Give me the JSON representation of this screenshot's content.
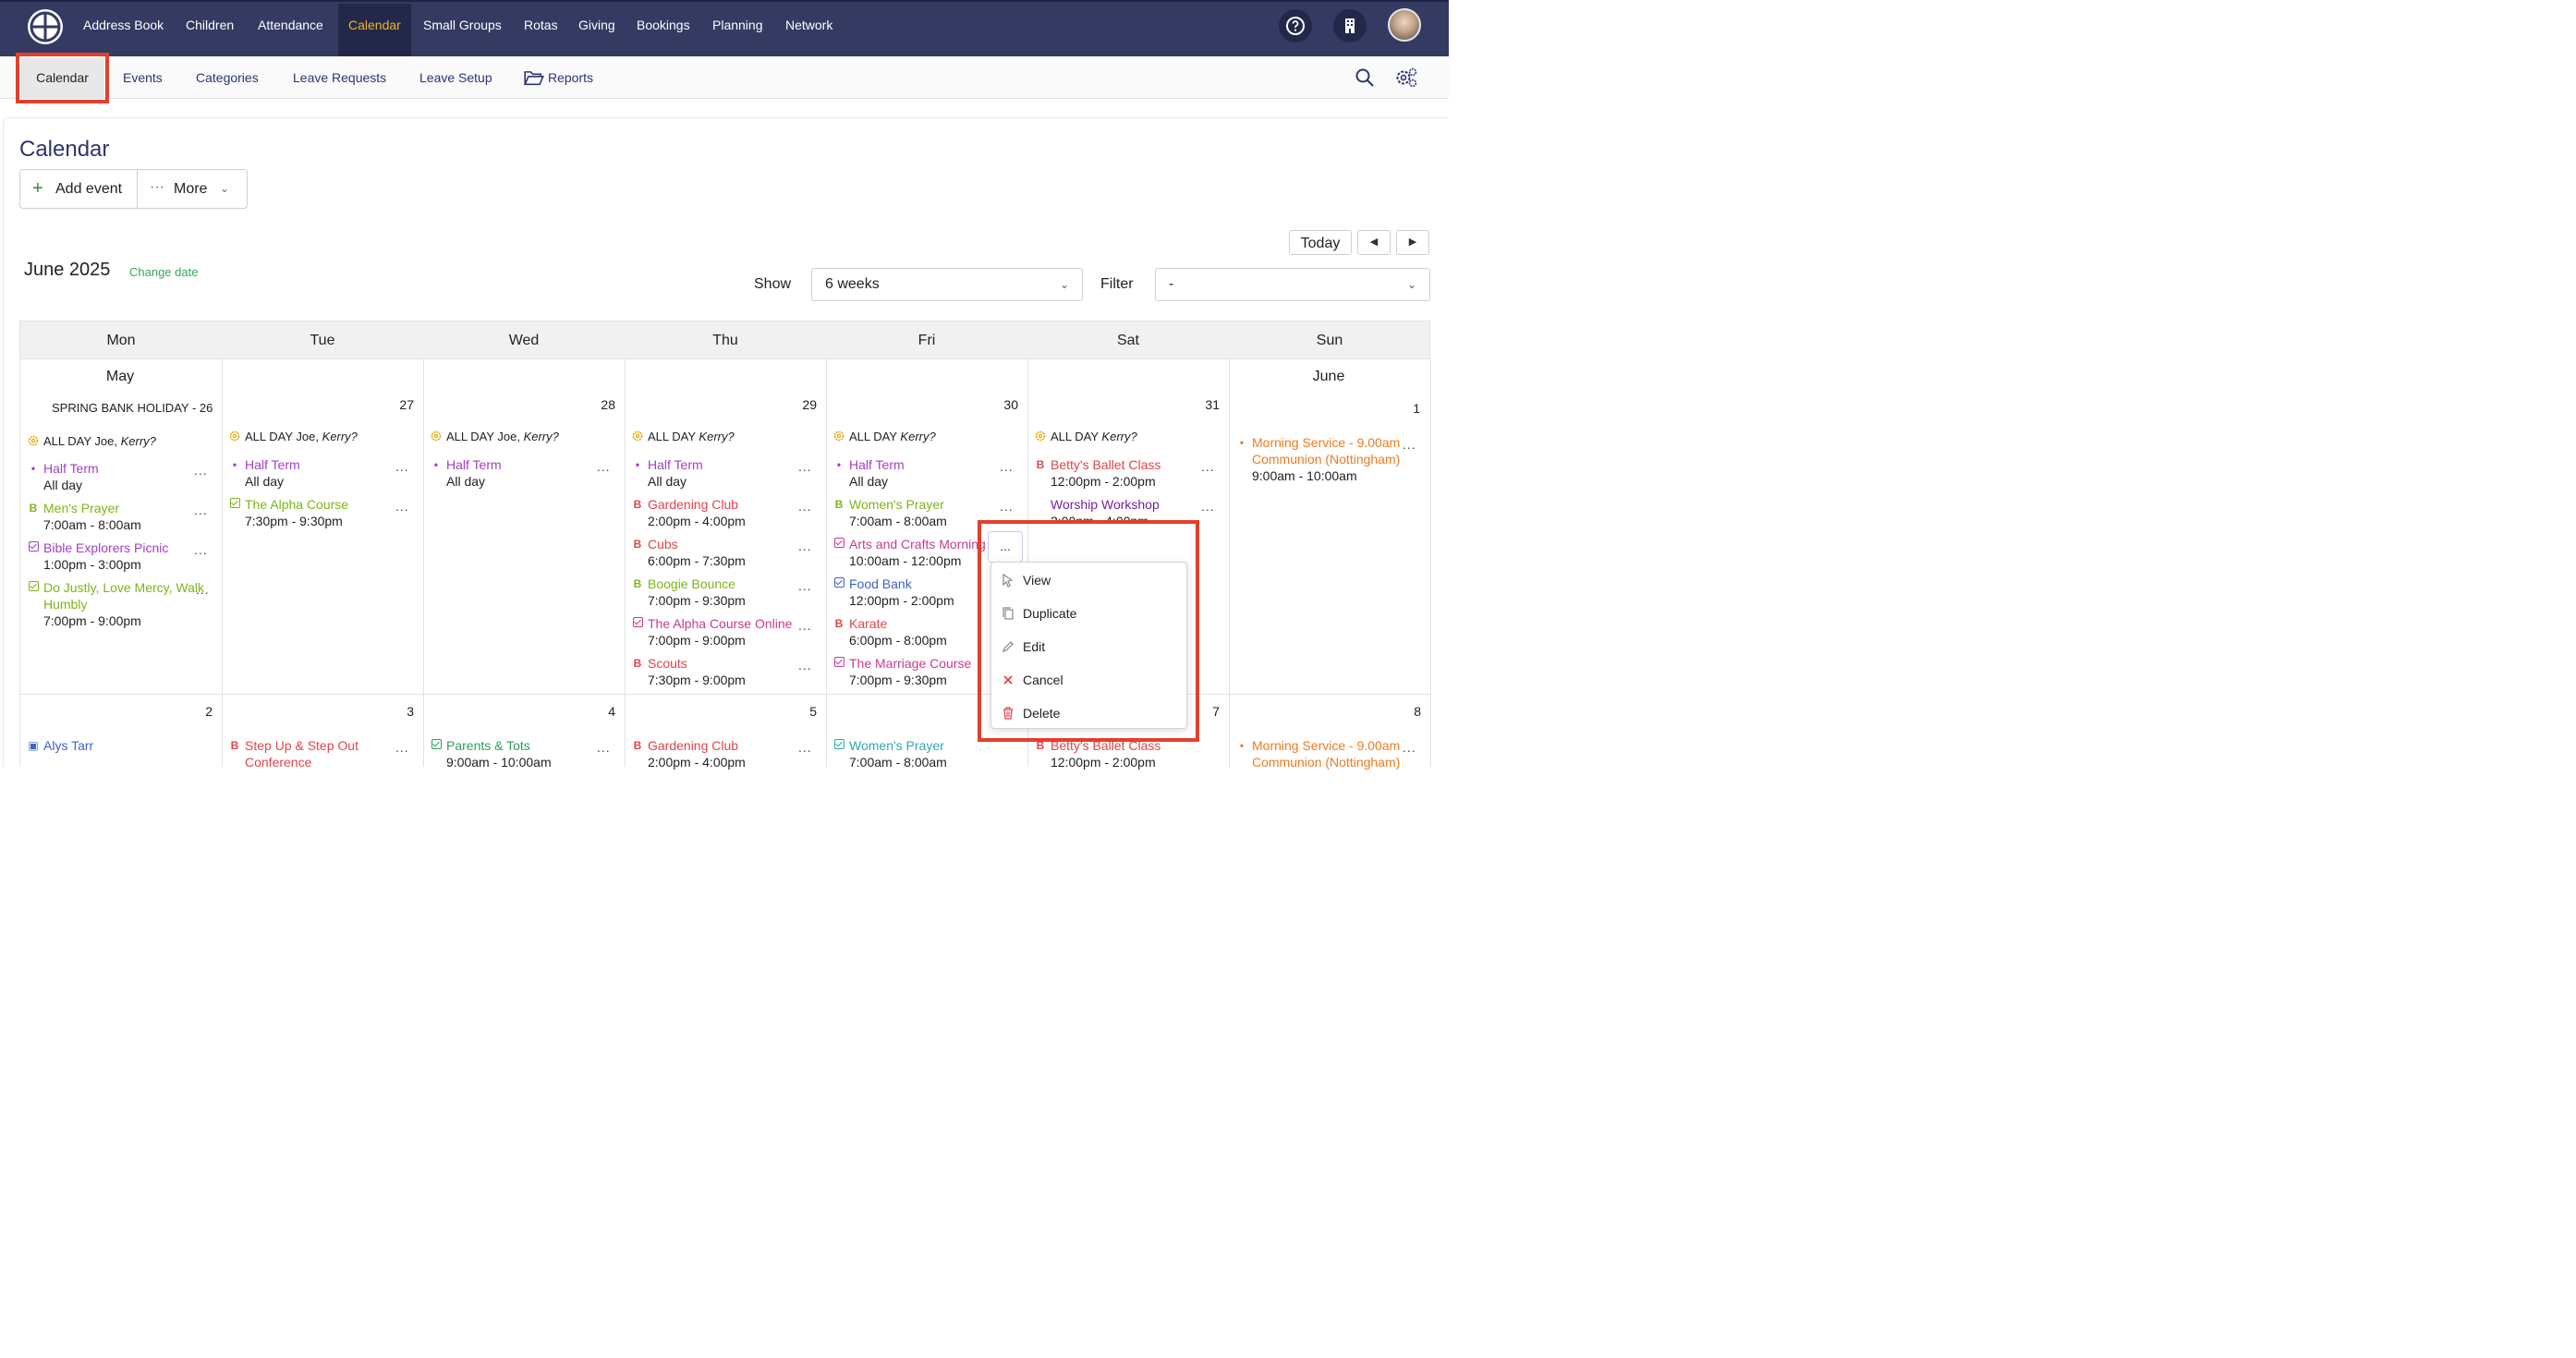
{
  "topnav": {
    "items": [
      "Address Book",
      "Children",
      "Attendance",
      "Calendar",
      "Small Groups",
      "Rotas",
      "Giving",
      "Bookings",
      "Planning",
      "Network"
    ],
    "active": "Calendar",
    "help_icon": "help-circle-icon",
    "building_icon": "building-icon",
    "avatar": "user-avatar"
  },
  "subnav": {
    "items": [
      "Calendar",
      "Events",
      "Categories",
      "Leave Requests",
      "Leave Setup",
      "Reports"
    ],
    "active": "Calendar",
    "reports_icon": "folder-open-icon",
    "search_icon": "search-icon",
    "settings_icon": "settings-gear-icon"
  },
  "page": {
    "title": "Calendar",
    "add_event": "Add event",
    "more": "More"
  },
  "calendar": {
    "month_label": "June 2025",
    "change_date": "Change date",
    "today": "Today",
    "show_label": "Show",
    "show_value": "6 weeks",
    "filter_label": "Filter",
    "filter_value": "-",
    "days": [
      "Mon",
      "Tue",
      "Wed",
      "Thu",
      "Fri",
      "Sat",
      "Sun"
    ],
    "week1": {
      "mon_month": "May",
      "mon_holiday": "SPRING BANK HOLIDAY - 26",
      "dates": [
        "27",
        "28",
        "29",
        "30",
        "31"
      ],
      "sun_month": "June",
      "sun_date": "1",
      "allday_prefix": "ALL DAY",
      "allday_mon_names": "Joe, ",
      "allday_mon_q": "Kerry?",
      "allday_kerry": "Kerry?"
    },
    "week2": {
      "dates": [
        "2",
        "3",
        "4",
        "5",
        "7",
        "8"
      ]
    },
    "events": {
      "mon": [
        {
          "title": "Half Term",
          "time": "All day"
        },
        {
          "title": "Men's Prayer",
          "time": "7:00am - 8:00am"
        },
        {
          "title": "Bible Explorers Picnic",
          "time": "1:00pm - 3:00pm"
        },
        {
          "title": "Do Justly, Love Mercy, Walk",
          "title2": "Humbly",
          "time": "7:00pm - 9:00pm"
        }
      ],
      "tue": [
        {
          "title": "Half Term",
          "time": "All day"
        },
        {
          "title": "The Alpha Course",
          "time": "7:30pm - 9:30pm"
        }
      ],
      "wed": [
        {
          "title": "Half Term",
          "time": "All day"
        }
      ],
      "thu": [
        {
          "title": "Half Term",
          "time": "All day"
        },
        {
          "title": "Gardening Club",
          "time": "2:00pm - 4:00pm"
        },
        {
          "title": "Cubs",
          "time": "6:00pm - 7:30pm"
        },
        {
          "title": "Boogie Bounce",
          "time": "7:00pm - 9:30pm"
        },
        {
          "title": "The Alpha Course Online",
          "time": "7:00pm - 9:00pm"
        },
        {
          "title": "Scouts",
          "time": "7:30pm - 9:00pm"
        }
      ],
      "fri": [
        {
          "title": "Half Term",
          "time": "All day"
        },
        {
          "title": "Women's Prayer",
          "time": "7:00am - 8:00am"
        },
        {
          "title": "Arts and Crafts Morning",
          "time": "10:00am - 12:00pm"
        },
        {
          "title": "Food Bank",
          "time": "12:00pm - 2:00pm"
        },
        {
          "title": "Karate",
          "time": "6:00pm - 8:00pm"
        },
        {
          "title": "The Marriage Course",
          "time": "7:00pm - 9:30pm"
        }
      ],
      "sat": [
        {
          "title": "Betty's Ballet Class",
          "time": "12:00pm - 2:00pm"
        },
        {
          "title": "Worship Workshop",
          "time": "2:00pm - 4:00pm"
        }
      ],
      "sun": [
        {
          "title": "Morning Service - 9.00am",
          "title2": "Communion (Nottingham)",
          "time": "9:00am - 10:00am"
        }
      ],
      "week2": {
        "mon": "Alys Tarr",
        "tue": "Step Up & Step Out",
        "tue2": "Conference",
        "wed": "Parents & Tots",
        "wed_time": "9:00am - 10:00am",
        "thu": "Gardening Club",
        "thu_time": "2:00pm - 4:00pm",
        "fri": "Women's Prayer",
        "fri_time": "7:00am - 8:00am",
        "sat": "Betty's Ballet Class",
        "sat_time": "12:00pm - 2:00pm",
        "sun": "Morning Service - 9.00am",
        "sun2": "Communion (Nottingham)"
      }
    },
    "markers": {
      "b": "B",
      "dot": "•",
      "more": "..."
    }
  },
  "context_menu": {
    "items": [
      "View",
      "Duplicate",
      "Edit",
      "Cancel",
      "Delete"
    ],
    "icons": [
      "cursor-icon",
      "copy-icon",
      "pencil-icon",
      "close-icon",
      "trash-icon"
    ]
  },
  "colors": {
    "nav_bg": "#343a62",
    "nav_active": "#f0b429",
    "highlight": "#e33f2a",
    "link": "#2c3570"
  }
}
